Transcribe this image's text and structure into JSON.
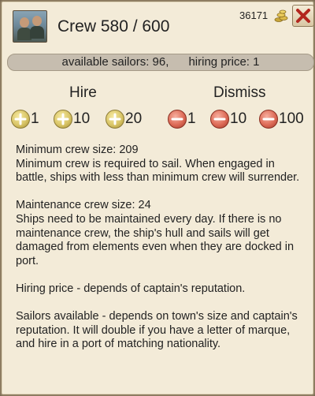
{
  "header": {
    "title": "Crew 580 / 600",
    "gold": "36171"
  },
  "info_bar": {
    "available": "available sailors: 96,",
    "price": "hiring price: 1"
  },
  "hire": {
    "label": "Hire",
    "buttons": [
      "1",
      "10",
      "20"
    ]
  },
  "dismiss": {
    "label": "Dismiss",
    "buttons": [
      "1",
      "10",
      "100"
    ]
  },
  "description": {
    "min_title": "Minimum crew size: 209",
    "min_text": "Minimum crew is required to sail. When engaged in battle, ships with less than minimum crew will surrender.",
    "maint_title": "Maintenance crew size: 24",
    "maint_text": "Ships need to be maintained every day. If there is no maintenance crew, the ship's hull and sails will get damaged from elements even when they are docked in port.",
    "hiring_price": "Hiring price - depends of captain's reputation.",
    "sailors_available": "Sailors available - depends on town's size and captain's reputation. It will double if you have a letter of marque, and hire in a port of matching nationality."
  },
  "colors": {
    "plus_button": "#d9c567",
    "minus_button": "#dd6b57",
    "close_x": "#b3261e"
  }
}
